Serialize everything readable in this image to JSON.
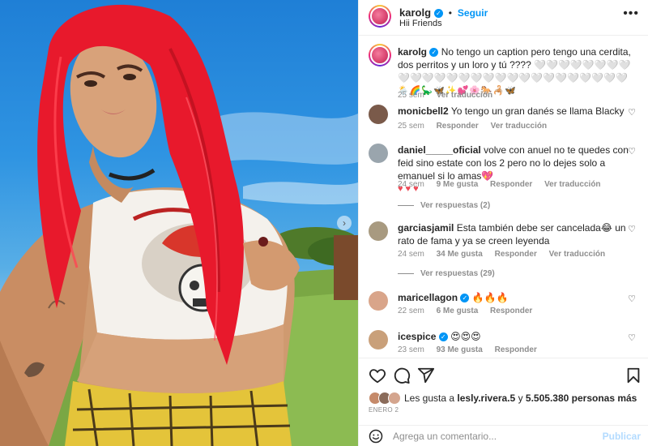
{
  "post": {
    "username": "karolg",
    "follow_label": "Seguir",
    "location": "Hii Friends",
    "more_label": "•••"
  },
  "caption": {
    "username": "karolg",
    "text": "No tengo un caption pero tengo una cerdita, dos perritos y un loro y tú ???? 🤍🤍🤍🤍🤍🤍🤍🤍🤍🤍🤍🤍🤍🤍🤍🤍🤍🤍🤍🤍🤍🤍🤍🤍🤍🤍🤍",
    "emojis": "🌦️🌈🦕🦋✨💕🌸🐎🦂🦋",
    "time": "25 sem",
    "translate": "Ver traducción"
  },
  "comments": [
    {
      "username": "monicbell2",
      "text": "Yo tengo un gran danés se llama Blacky",
      "time": "25 sem",
      "reply": "Responder",
      "translate": "Ver traducción"
    },
    {
      "username": "daniel_____oficial",
      "text": "volve con anuel no te quedes con feid sino estate con los 2 pero no lo dejes solo a emanuel si lo amas💖",
      "hearts": "♥♥♥",
      "time": "24 sem",
      "likes": "9 Me gusta",
      "reply": "Responder",
      "translate": "Ver traducción",
      "replies": "Ver respuestas (2)"
    },
    {
      "username": "garciasjamil",
      "text": "Esta también debe ser cancelada😂 un rato de fama y ya se creen leyenda",
      "time": "24 sem",
      "likes": "34 Me gusta",
      "reply": "Responder",
      "translate": "Ver traducción",
      "replies": "Ver respuestas (29)"
    },
    {
      "username": "maricellagon",
      "text": "🔥🔥🔥",
      "time": "22 sem",
      "likes": "6 Me gusta",
      "reply": "Responder"
    },
    {
      "username": "icespice",
      "text": "😍😍😍",
      "time": "23 sem",
      "likes": "93 Me gusta",
      "reply": "Responder"
    }
  ],
  "likes": {
    "prefix": "Les gusta a",
    "user": "lesly.rivera.5",
    "connector": "y",
    "count": "5.505.380 personas más"
  },
  "date": "ENERO 2",
  "add_comment": {
    "placeholder": "Agrega un comentario...",
    "post_label": "Publicar"
  },
  "colors": {
    "accent": "#0095f6",
    "like_red": "#ed4956",
    "muted": "#8e8e8e",
    "hair_red": "#e8192c"
  }
}
